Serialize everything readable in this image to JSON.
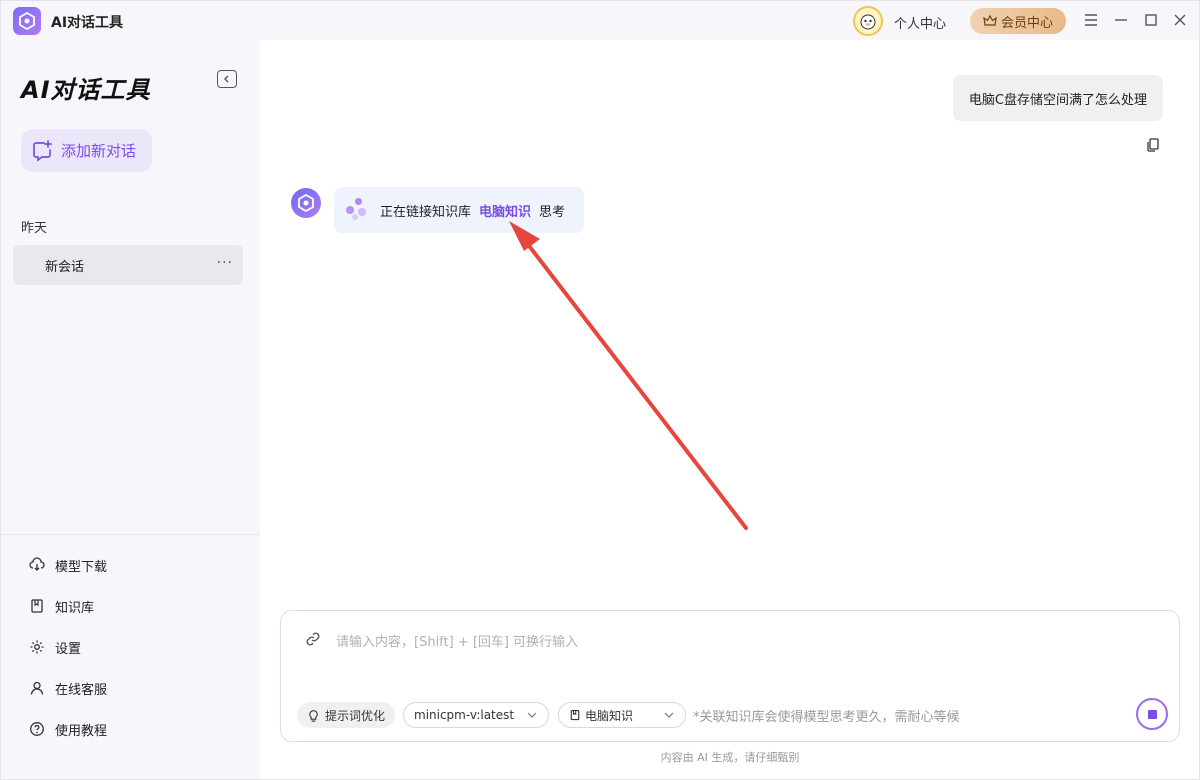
{
  "titlebar": {
    "app_title": "AI对话工具",
    "personal_center": "个人中心",
    "member_center": "会员中心"
  },
  "sidebar": {
    "brand": "AI对话工具",
    "new_chat_label": "添加新对话",
    "section_label": "昨天",
    "conversations": [
      {
        "title": "新会话",
        "more": "···"
      }
    ],
    "menu": [
      {
        "label": "模型下载",
        "icon": "cloud-download-icon"
      },
      {
        "label": "知识库",
        "icon": "book-icon"
      },
      {
        "label": "设置",
        "icon": "gear-icon"
      },
      {
        "label": "在线客服",
        "icon": "user-icon"
      },
      {
        "label": "使用教程",
        "icon": "help-icon"
      }
    ]
  },
  "chat": {
    "user_message": "电脑C盘存储空间满了怎么处理",
    "bot_status_prefix": "正在链接知识库",
    "bot_status_kb": "电脑知识",
    "bot_status_suffix": "思考"
  },
  "input": {
    "placeholder": "请输入内容，[Shift] + [回车] 可换行输入",
    "prompt_optimize": "提示词优化",
    "model_select": "minicpm-v:latest",
    "kb_select": "电脑知识",
    "hint": "*关联知识库会使得模型思考更久，需耐心等候"
  },
  "footer": "内容由 AI 生成，请仔细甄别",
  "colors": {
    "accent": "#7a4de6",
    "annotation_arrow": "#e8453c"
  }
}
